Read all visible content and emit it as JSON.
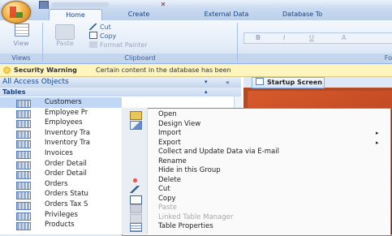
{
  "ribbon": {
    "tabs": [
      "Home",
      "Create",
      "External Data",
      "Database To"
    ],
    "view_label": "View",
    "paste_label": "Paste",
    "cut_label": "Cut",
    "copy_label": "Copy",
    "format_painter_label": "Format Painter",
    "groups": [
      "Views",
      "Clipboard",
      "Fo"
    ],
    "font_buttons": [
      "B",
      "I",
      "U",
      "A"
    ]
  },
  "security": {
    "title": "Security Warning",
    "message": "Certain content in the database has been"
  },
  "nav": {
    "header": "All Access Objects",
    "group": "Tables",
    "items": [
      "Customers",
      "Employee Pr",
      "Employees",
      "Inventory Tra",
      "Inventory Tra",
      "Invoices",
      "Order Detail",
      "Order Detail",
      "Orders",
      "Orders Statu",
      "Orders Tax S",
      "Privileges",
      "Products"
    ]
  },
  "document": {
    "tab_label": "Startup Screen"
  },
  "context_menu": {
    "items": [
      {
        "label": "Open",
        "enabled": true,
        "icon": "open-icon",
        "submenu": false
      },
      {
        "label": "Design View",
        "enabled": true,
        "icon": "design-view-icon",
        "submenu": false
      },
      {
        "label": "Import",
        "enabled": true,
        "icon": "",
        "submenu": true
      },
      {
        "label": "Export",
        "enabled": true,
        "icon": "",
        "submenu": true
      },
      {
        "label": "Collect and Update Data via E-mail",
        "enabled": true,
        "icon": "",
        "submenu": false
      },
      {
        "label": "Rename",
        "enabled": true,
        "icon": "",
        "submenu": false
      },
      {
        "label": "Hide in this Group",
        "enabled": true,
        "icon": "",
        "submenu": false
      },
      {
        "label": "Delete",
        "enabled": true,
        "icon": "delete-icon",
        "submenu": false
      },
      {
        "label": "Cut",
        "enabled": true,
        "icon": "cut-icon",
        "submenu": false
      },
      {
        "label": "Copy",
        "enabled": true,
        "icon": "copy-icon",
        "submenu": false
      },
      {
        "label": "Paste",
        "enabled": false,
        "icon": "paste-icon",
        "submenu": false
      },
      {
        "label": "Linked Table Manager",
        "enabled": false,
        "icon": "linked-table-icon",
        "submenu": false
      },
      {
        "label": "Table Properties",
        "enabled": true,
        "icon": "properties-icon",
        "submenu": false
      }
    ]
  },
  "colors": {
    "ribbon_blue": "#15428b",
    "warning_bg": "#fdf4be",
    "selection": "#c1d7f5",
    "doc_bg": "#b24a26"
  }
}
